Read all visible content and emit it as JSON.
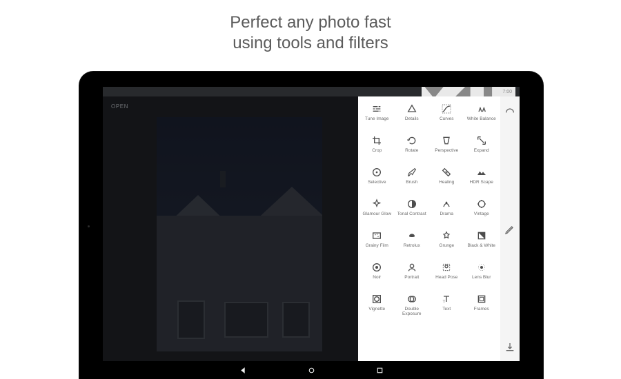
{
  "headline": {
    "line1": "Perfect any photo fast",
    "line2": "using tools and filters"
  },
  "statusbar": {
    "time": "7:00"
  },
  "editor": {
    "open_label": "OPEN"
  },
  "tools": [
    {
      "id": "tune-image",
      "label": "Tune Image"
    },
    {
      "id": "details",
      "label": "Details"
    },
    {
      "id": "curves",
      "label": "Curves"
    },
    {
      "id": "white-balance",
      "label": "White Balance"
    },
    {
      "id": "crop",
      "label": "Crop"
    },
    {
      "id": "rotate",
      "label": "Rotate"
    },
    {
      "id": "perspective",
      "label": "Perspective"
    },
    {
      "id": "expand",
      "label": "Expand"
    },
    {
      "id": "selective",
      "label": "Selective"
    },
    {
      "id": "brush",
      "label": "Brush"
    },
    {
      "id": "healing",
      "label": "Healing"
    },
    {
      "id": "hdr-scape",
      "label": "HDR Scape"
    },
    {
      "id": "glamour-glow",
      "label": "Glamour Glow"
    },
    {
      "id": "tonal-contrast",
      "label": "Tonal Contrast"
    },
    {
      "id": "drama",
      "label": "Drama"
    },
    {
      "id": "vintage",
      "label": "Vintage"
    },
    {
      "id": "grainy-film",
      "label": "Grainy Film"
    },
    {
      "id": "retrolux",
      "label": "Retrolux"
    },
    {
      "id": "grunge",
      "label": "Grunge"
    },
    {
      "id": "black-white",
      "label": "Black & White"
    },
    {
      "id": "noir",
      "label": "Noir"
    },
    {
      "id": "portrait",
      "label": "Portrait"
    },
    {
      "id": "head-pose",
      "label": "Head Pose"
    },
    {
      "id": "lens-blur",
      "label": "Lens Blur"
    },
    {
      "id": "vignette",
      "label": "Vignette"
    },
    {
      "id": "double-exposure",
      "label": "Double Exposure"
    },
    {
      "id": "text",
      "label": "Text"
    },
    {
      "id": "frames",
      "label": "Frames"
    }
  ],
  "rail": {
    "styles_icon": "styles-icon",
    "edit_icon": "pencil-icon",
    "export_icon": "export-icon"
  },
  "nav": {
    "back": "back",
    "home": "home",
    "recent": "recent"
  }
}
